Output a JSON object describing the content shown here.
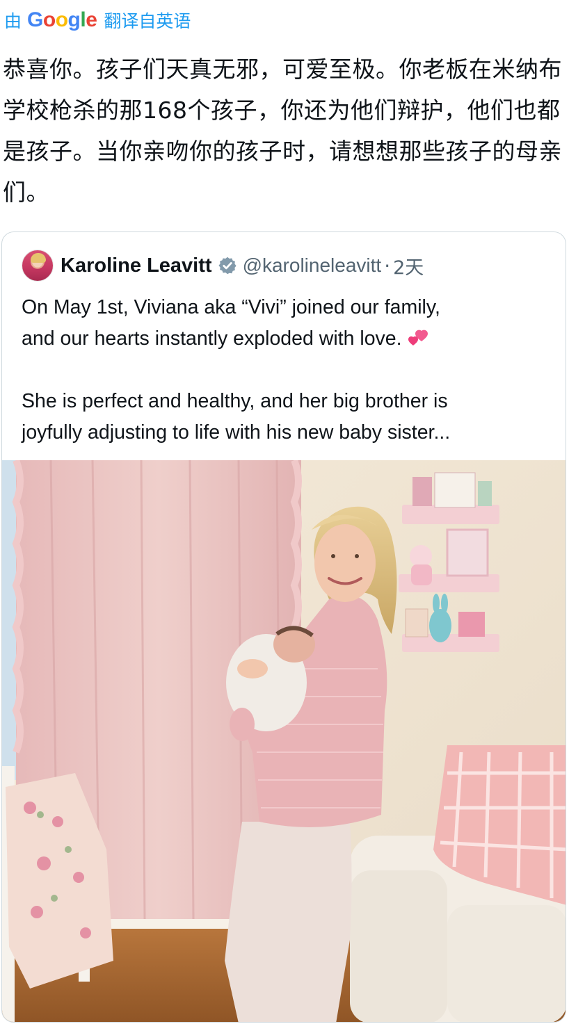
{
  "translate_bar": {
    "by": "由",
    "google_letters": [
      "G",
      "o",
      "o",
      "g",
      "l",
      "e"
    ],
    "label": "翻译自英语"
  },
  "translated_text": "恭喜你。孩子们天真无邪，可爱至极。你老板在米纳布学校枪杀的那168个孩子，你还为他们辩护，他们也都是孩子。当你亲吻你的孩子时，请想想那些孩子的母亲们。",
  "quote": {
    "display_name": "Karoline Leavitt",
    "handle": "@karolineleavitt",
    "separator": "·",
    "time": "2天",
    "line1": "On May 1st, Viviana aka “Vivi” joined our family,",
    "line2": "and our hearts instantly exploded with love.",
    "line3": "She is perfect and healthy, and her big brother is",
    "line4": "joyfully adjusting to life with his new baby sister..."
  },
  "icons": {
    "verified": "verified-badge-icon",
    "hearts": "two-hearts-emoji-icon",
    "avatar": "profile-avatar"
  },
  "colors": {
    "link_blue": "#1d9bf0",
    "text": "#0f1419",
    "secondary": "#536471",
    "border": "#cfd9de",
    "verified_gray": "#829aab",
    "heart_pink": "#f25a8f"
  }
}
